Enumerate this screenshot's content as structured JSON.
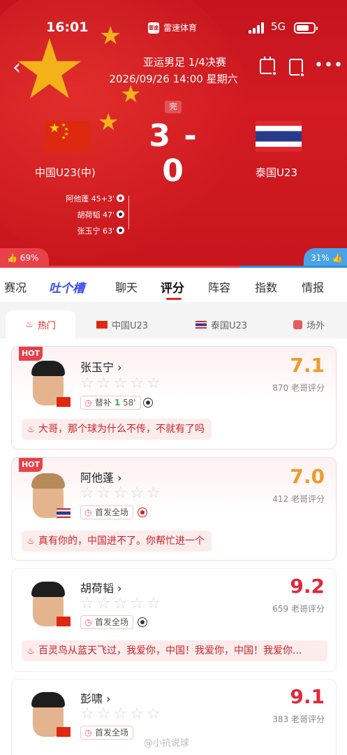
{
  "status_bar": {
    "time": "16:01",
    "app_name": "雷速体育",
    "app_logo_text": "雷速",
    "network": "5G"
  },
  "match": {
    "competition": "亚运男足 1/4决赛",
    "datetime": "2026/09/26 14:00  星期六",
    "status": "完",
    "score": "3 - 0",
    "home_team": "中国U23(中)",
    "away_team": "泰国U23",
    "goals": [
      {
        "text": "阿他蓬 45+3'",
        "type": "penalty"
      },
      {
        "text": "胡荷韬 47'",
        "type": "goal"
      },
      {
        "text": "张玉宁 63'",
        "type": "goal"
      }
    ],
    "home_vote": "69%",
    "away_vote": "31%"
  },
  "tabs": [
    {
      "label": "赛况"
    },
    {
      "label": "吐个槽"
    },
    {
      "label": "聊天"
    },
    {
      "label": "评分"
    },
    {
      "label": "阵容"
    },
    {
      "label": "指数"
    },
    {
      "label": "情报"
    }
  ],
  "subtabs": [
    {
      "label": "热门"
    },
    {
      "label": "中国U23"
    },
    {
      "label": "泰国U23"
    },
    {
      "label": "场外"
    }
  ],
  "players": [
    {
      "hot": "HOT",
      "name": "张玉宁 ›",
      "role_prefix": "替补",
      "role_in": "1",
      "role_min": "58'",
      "rating": "7.1",
      "votes": "870 老哥评分",
      "comment": "大哥，那个球为什么不传，不就有了吗"
    },
    {
      "hot": "HOT",
      "name": "阿他蓬 ›",
      "role": "首发全场",
      "rating": "7.0",
      "votes": "412 老哥评分",
      "comment": "真有你的，中国进不了。你帮忙进一个"
    },
    {
      "name": "胡荷韬 ›",
      "role": "首发全场",
      "rating": "9.2",
      "votes": "659 老哥评分",
      "comment": "百灵鸟从蓝天飞过，我爱你，中国！我爱你，中国！我爱你..."
    },
    {
      "name": "彭啸 ›",
      "role": "首发全场",
      "rating": "9.1",
      "votes": "383 老哥评分"
    }
  ],
  "watermark": "@小抗说球",
  "colors": {
    "header_red": "#d21b22",
    "accent_red": "#e02828",
    "rating_orange": "#ee9a2c",
    "rating_red": "#e0283c",
    "away_blue": "#4aa3e6"
  }
}
